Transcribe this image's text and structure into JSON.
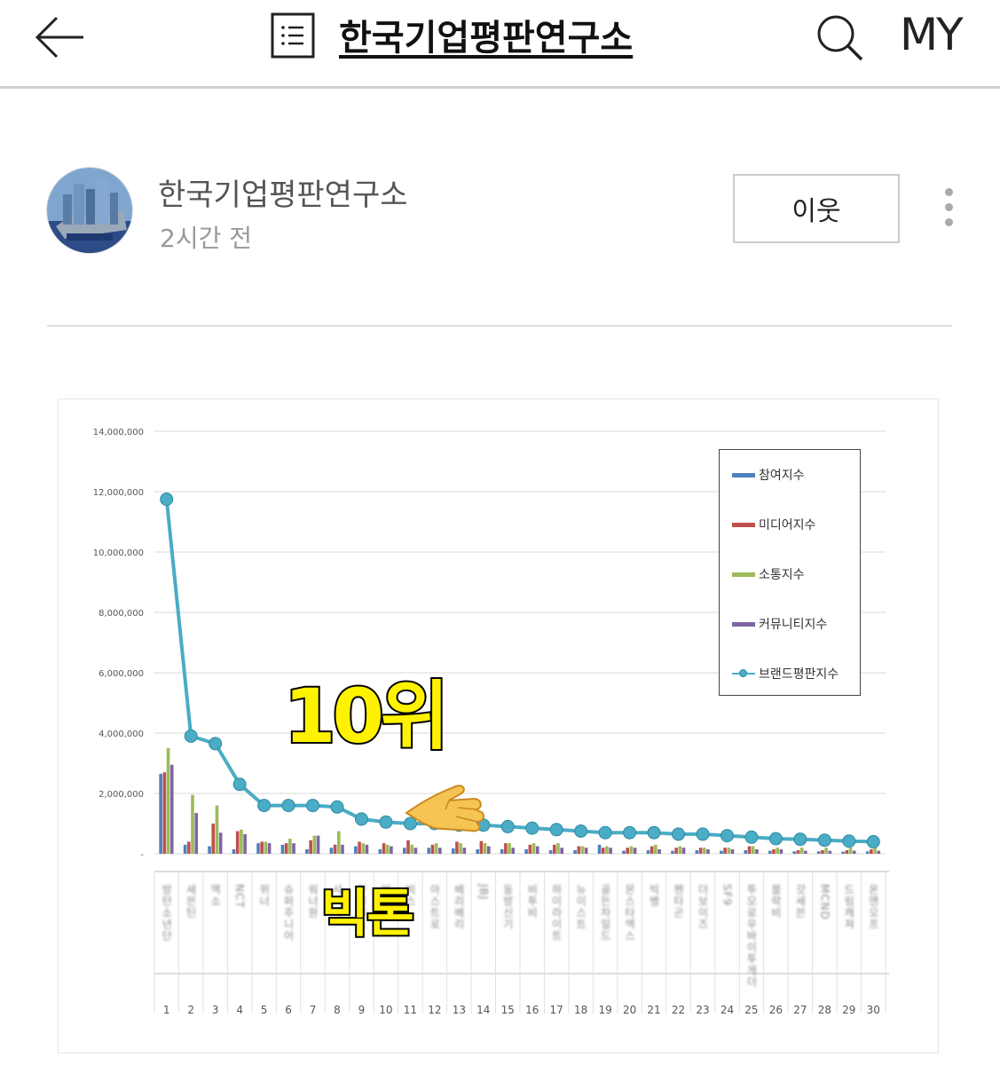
{
  "header": {
    "blog_title": "한국기업평판연구소",
    "my_label": "MY",
    "icons": [
      "back-arrow-icon",
      "document-list-icon",
      "search-icon"
    ]
  },
  "post": {
    "author": "한국기업평판연구소",
    "time": "2시간 전",
    "neighbor_button": "이웃",
    "avatar_text": "한국기업평판연구소"
  },
  "overlay": {
    "rank_label": "10위",
    "name_label": "빅톤"
  },
  "chart_data": {
    "type": "bar",
    "title": "",
    "xlabel": "",
    "ylabel": "",
    "ylim": [
      0,
      14000000
    ],
    "yticks": [
      "-",
      "2,000,000",
      "4,000,000",
      "6,000,000",
      "8,000,000",
      "10,000,000",
      "12,000,000",
      "14,000,000"
    ],
    "grid": true,
    "legend_position": "top-right",
    "categories": [
      "1",
      "2",
      "3",
      "4",
      "5",
      "6",
      "7",
      "8",
      "9",
      "10",
      "11",
      "12",
      "13",
      "14",
      "15",
      "16",
      "17",
      "18",
      "19",
      "20",
      "21",
      "22",
      "23",
      "24",
      "25",
      "26",
      "27",
      "28",
      "29",
      "30"
    ],
    "series": [
      {
        "name": "참여지수",
        "kind": "bar",
        "color": "#4f81bd",
        "values": [
          2650000,
          300000,
          250000,
          150000,
          350000,
          300000,
          150000,
          200000,
          250000,
          150000,
          200000,
          200000,
          180000,
          150000,
          150000,
          150000,
          120000,
          120000,
          300000,
          100000,
          120000,
          100000,
          120000,
          100000,
          120000,
          100000,
          80000,
          80000,
          70000,
          80000
        ]
      },
      {
        "name": "미디어지수",
        "kind": "bar",
        "color": "#c0504d",
        "values": [
          2700000,
          400000,
          1000000,
          750000,
          400000,
          350000,
          450000,
          300000,
          400000,
          350000,
          450000,
          300000,
          400000,
          420000,
          350000,
          300000,
          300000,
          250000,
          200000,
          200000,
          250000,
          200000,
          200000,
          200000,
          250000,
          150000,
          120000,
          120000,
          120000,
          150000
        ]
      },
      {
        "name": "소통지수",
        "kind": "bar",
        "color": "#9bbb59",
        "values": [
          3500000,
          1950000,
          1600000,
          800000,
          400000,
          500000,
          600000,
          750000,
          350000,
          300000,
          300000,
          350000,
          350000,
          350000,
          350000,
          350000,
          350000,
          250000,
          250000,
          250000,
          300000,
          250000,
          200000,
          200000,
          250000,
          200000,
          200000,
          200000,
          200000,
          200000
        ]
      },
      {
        "name": "커뮤니티지수",
        "kind": "bar",
        "color": "#8064a2",
        "values": [
          2950000,
          1350000,
          700000,
          650000,
          350000,
          350000,
          600000,
          300000,
          300000,
          250000,
          200000,
          200000,
          200000,
          250000,
          200000,
          250000,
          200000,
          200000,
          200000,
          200000,
          150000,
          200000,
          150000,
          150000,
          150000,
          150000,
          100000,
          100000,
          100000,
          100000
        ]
      },
      {
        "name": "브랜드평판지수",
        "kind": "line",
        "color": "#4aacc5",
        "values": [
          11750000,
          3900000,
          3650000,
          2300000,
          1600000,
          1600000,
          1600000,
          1550000,
          1150000,
          1050000,
          1000000,
          1000000,
          950000,
          950000,
          900000,
          850000,
          800000,
          750000,
          700000,
          700000,
          700000,
          650000,
          650000,
          600000,
          550000,
          500000,
          480000,
          450000,
          420000,
          400000
        ]
      }
    ],
    "x_labels": [
      "방탄소년단",
      "세븐틴",
      "엑소",
      "NCT",
      "위너",
      "슈퍼주니어",
      "워너원",
      "샤이니",
      "인피니트",
      "빅톤",
      "빅스",
      "아스트로",
      "베리베리",
      "JBJ",
      "동방신기",
      "비투비",
      "하이라이트",
      "뉴이스트",
      "골든차일드",
      "몬스타엑스",
      "빅뱅",
      "펜타곤",
      "더보이즈",
      "SF9",
      "투모로우바이투게더",
      "블락비",
      "갓세븐",
      "MCND",
      "드림캐쳐",
      "온앤오프"
    ]
  }
}
